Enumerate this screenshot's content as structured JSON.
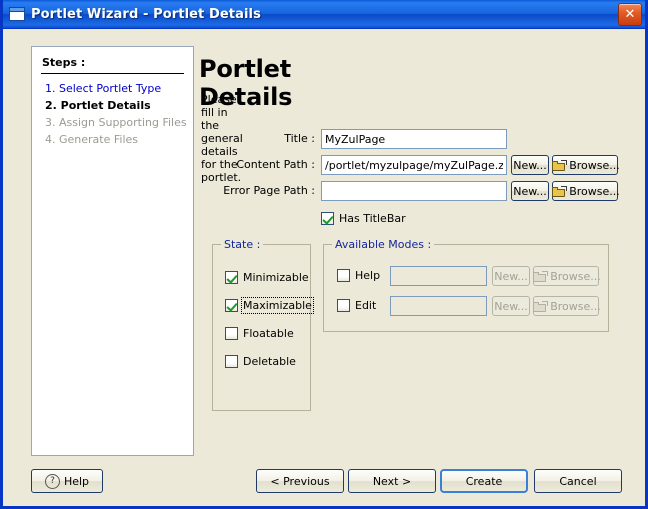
{
  "window": {
    "title": "Portlet Wizard - Portlet Details",
    "icon": "window-icon",
    "close_label": "✕",
    "frame_color": "#0736c4",
    "dialog_bg": "#ece9d8"
  },
  "steps": {
    "heading": "Steps :",
    "items": [
      {
        "label": "1. Select Portlet Type",
        "state": "link"
      },
      {
        "label": "2. Portlet Details",
        "state": "current"
      },
      {
        "label": "3. Assign Supporting Files",
        "state": "disabled"
      },
      {
        "label": "4. Generate Files",
        "state": "disabled"
      }
    ]
  },
  "page": {
    "title": "Portlet Details",
    "subtitle": "Please fill in the general details for the portlet."
  },
  "form": {
    "title_field": {
      "label": "Title :",
      "value": "MyZulPage",
      "placeholder": ""
    },
    "content_path_field": {
      "label": "Content Path :",
      "value": "/portlet/myzulpage/myZulPage.zul",
      "placeholder": "",
      "new_label": "New...",
      "browse_label": "Browse..."
    },
    "error_page_field": {
      "label": "Error Page Path :",
      "value": "",
      "placeholder": "",
      "new_label": "New...",
      "browse_label": "Browse..."
    },
    "has_titlebar": {
      "label": "Has TitleBar",
      "checked": true
    }
  },
  "state_group": {
    "legend": "State :",
    "options": [
      {
        "label": "Minimizable",
        "checked": true,
        "focused": false
      },
      {
        "label": "Maximizable",
        "checked": true,
        "focused": true
      },
      {
        "label": "Floatable",
        "checked": false,
        "focused": false
      },
      {
        "label": "Deletable",
        "checked": false,
        "focused": false
      }
    ]
  },
  "modes_group": {
    "legend": "Available Modes :",
    "rows": [
      {
        "label": "Help",
        "checked": false,
        "value": "",
        "new_label": "New...",
        "browse_label": "Browse...",
        "disabled": true
      },
      {
        "label": "Edit",
        "checked": false,
        "value": "",
        "new_label": "New...",
        "browse_label": "Browse...",
        "disabled": true
      }
    ]
  },
  "footer": {
    "help_label": "Help",
    "previous_label": "< Previous",
    "next_label": "Next >",
    "create_label": "Create",
    "cancel_label": "Cancel",
    "default_button": "Create"
  }
}
